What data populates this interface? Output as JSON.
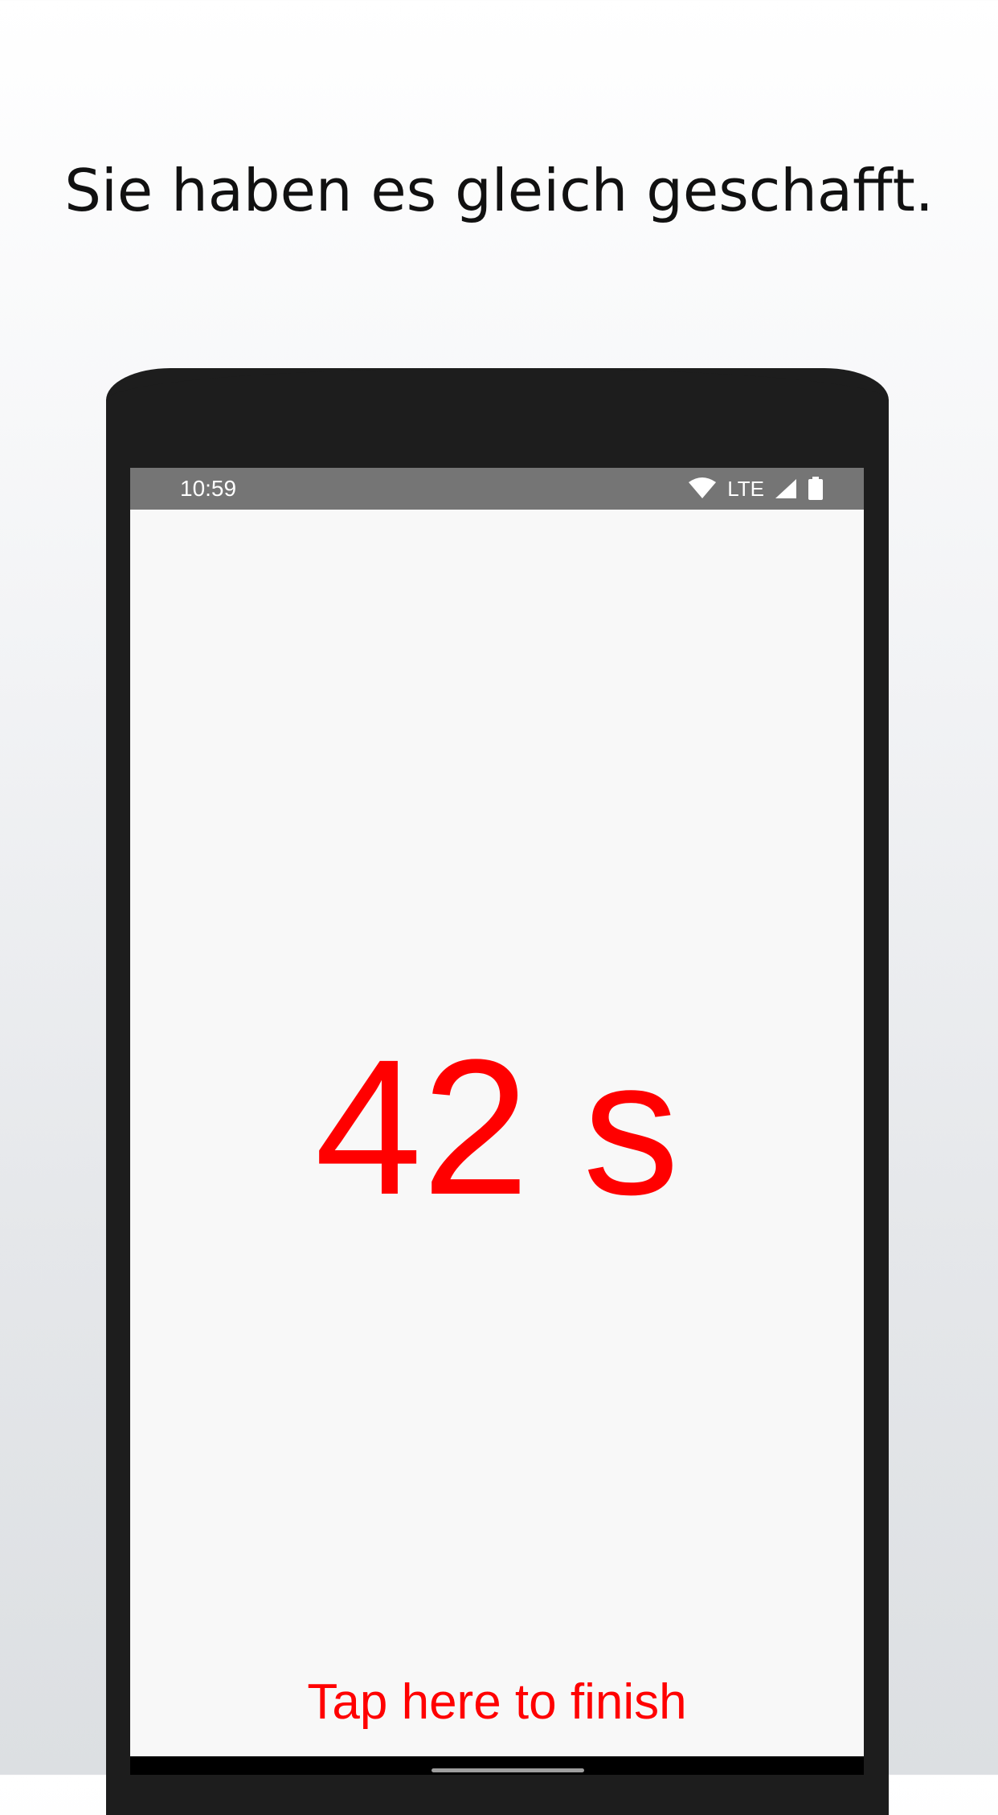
{
  "headline": "Sie haben es gleich geschafft.",
  "status_bar": {
    "time": "10:59",
    "network": "LTE",
    "icons": [
      "wifi-icon",
      "signal-icon",
      "battery-icon"
    ]
  },
  "countdown": {
    "value": "42 s"
  },
  "finish_label": "Tap here to finish",
  "colors": {
    "accent": "#ff0000",
    "status_bar": "#757575",
    "device_frame": "#1d1d1d"
  }
}
